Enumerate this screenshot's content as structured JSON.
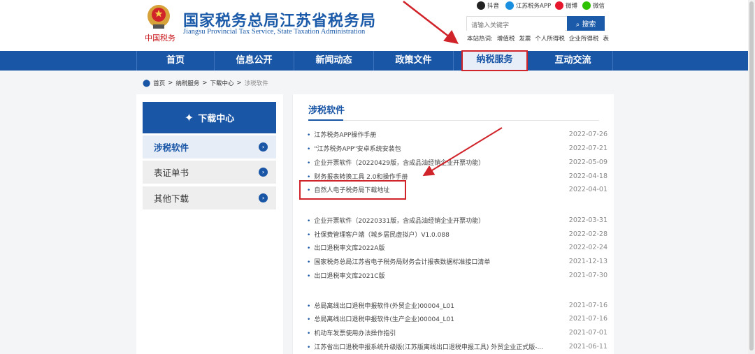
{
  "header": {
    "title": "国家税务总局江苏省税务局",
    "subtitle": "Jiangsu Provincial Tax Service, State Taxation Administration",
    "slogan": "中国税务",
    "social": [
      {
        "label": "抖音",
        "color": "#222222"
      },
      {
        "label": "江苏税务APP",
        "color": "#1a8fe0"
      },
      {
        "label": "微博",
        "color": "#e6162d"
      },
      {
        "label": "微信",
        "color": "#2dc100"
      }
    ],
    "search": {
      "placeholder": "请输入关键字",
      "button": "搜索"
    },
    "hot_label": "本站热词:",
    "hot_words": [
      "增值税",
      "发票",
      "个人所得税",
      "企业所得税",
      "表"
    ]
  },
  "nav": [
    "首页",
    "信息公开",
    "新闻动态",
    "政策文件",
    "纳税服务",
    "互动交流"
  ],
  "breadcrumb": [
    "首页",
    "纳税服务",
    "下载中心",
    "涉税软件"
  ],
  "sidebar": {
    "title": "下载中心",
    "items": [
      "涉税软件",
      "表证单书",
      "其他下载"
    ]
  },
  "main": {
    "title": "涉税软件",
    "items": [
      {
        "title": "江苏税务APP操作手册",
        "date": "2022-07-26"
      },
      {
        "title": "\"江苏税务APP\"安卓系统安装包",
        "date": "2022-07-21"
      },
      {
        "title": "企业开票软件（20220429版，含成品油经销企业开票功能）",
        "date": "2022-05-09"
      },
      {
        "title": "财务报表转换工具 2.0和操作手册",
        "date": "2022-04-18"
      },
      {
        "title": "自然人电子税务局下载地址",
        "date": "2022-04-01"
      },
      {
        "title": "企业开票软件（20220331版，含成品油经销企业开票功能）",
        "date": "2022-03-31"
      },
      {
        "title": "社保费管理客户端（城乡居民虚拟户）V1.0.088",
        "date": "2022-02-28"
      },
      {
        "title": "出口退税率文库2022A版",
        "date": "2022-02-24"
      },
      {
        "title": "国家税务总局江苏省电子税务局财务会计报表数据标准接口清单",
        "date": "2021-12-13"
      },
      {
        "title": "出口退税率文库2021C版",
        "date": "2021-07-30"
      },
      {
        "title": "总局离线出口退税申报软件(外贸企业)00004_L01",
        "date": "2021-07-16"
      },
      {
        "title": "总局离线出口退税申报软件(生产企业)00004_L01",
        "date": "2021-07-16"
      },
      {
        "title": "机动车发票使用办法操作指引",
        "date": "2021-07-01"
      },
      {
        "title": "江苏省出口退税申报系统升级版(江苏版离线出口退税申报工具) 外贸企业正式版-...",
        "date": "2021-06-11"
      }
    ]
  }
}
